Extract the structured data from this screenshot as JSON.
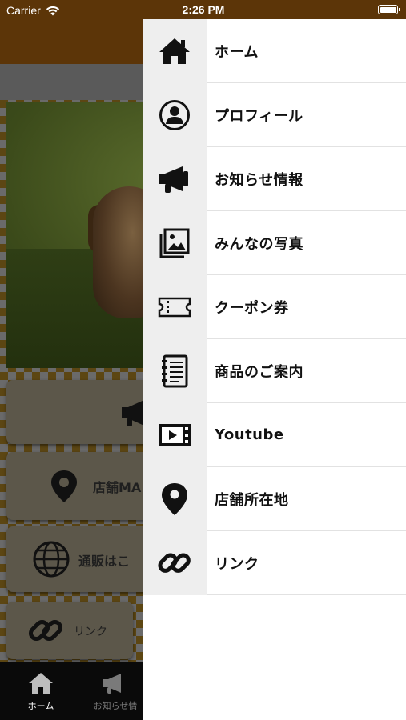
{
  "status_bar": {
    "carrier": "Carrier",
    "time": "2:26 PM"
  },
  "background": {
    "cards": [
      {
        "label": "店舗MA"
      },
      {
        "label": "通販はこ"
      },
      {
        "label": "リンク"
      }
    ],
    "tabs": [
      {
        "label": "ホーム",
        "icon": "home-icon"
      },
      {
        "label": "お知らせ情",
        "icon": "megaphone-icon"
      }
    ]
  },
  "drawer": {
    "items": [
      {
        "label": "ホーム",
        "icon": "home-icon"
      },
      {
        "label": "プロフィール",
        "icon": "profile-icon"
      },
      {
        "label": "お知らせ情報",
        "icon": "megaphone-icon"
      },
      {
        "label": "みんなの写真",
        "icon": "photo-gallery-icon"
      },
      {
        "label": "クーポン券",
        "icon": "ticket-icon"
      },
      {
        "label": "商品のご案内",
        "icon": "notebook-icon"
      },
      {
        "label": "Youtube",
        "icon": "video-icon"
      },
      {
        "label": "店舗所在地",
        "icon": "map-pin-icon"
      },
      {
        "label": "リンク",
        "icon": "link-icon"
      }
    ]
  },
  "colors": {
    "nav_brown": "#5c3508",
    "drawer_bg": "#ffffff",
    "icon_cell_bg": "#eeeeee"
  }
}
